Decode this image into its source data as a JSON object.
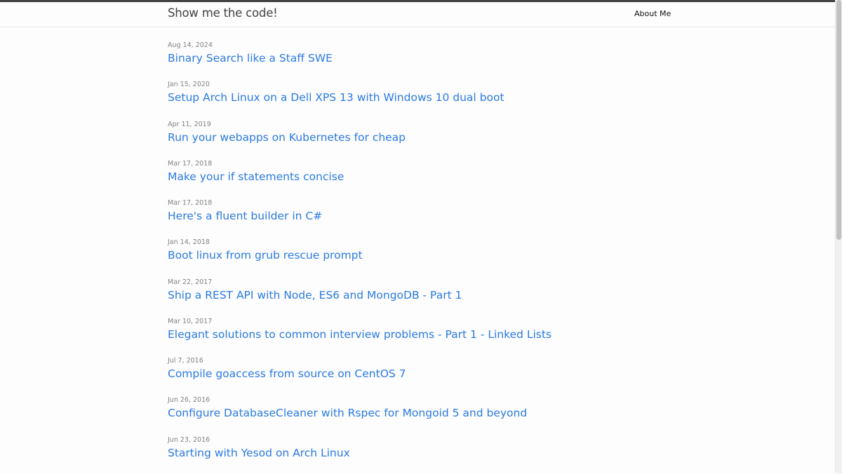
{
  "header": {
    "site_title": "Show me the code!",
    "nav_about": "About Me"
  },
  "posts": [
    {
      "date": "Aug 14, 2024",
      "title": "Binary Search like a Staff SWE"
    },
    {
      "date": "Jan 15, 2020",
      "title": "Setup Arch Linux on a Dell XPS 13 with Windows 10 dual boot"
    },
    {
      "date": "Apr 11, 2019",
      "title": "Run your webapps on Kubernetes for cheap"
    },
    {
      "date": "Mar 17, 2018",
      "title": "Make your if statements concise"
    },
    {
      "date": "Mar 17, 2018",
      "title": "Here's a fluent builder in C#"
    },
    {
      "date": "Jan 14, 2018",
      "title": "Boot linux from grub rescue prompt"
    },
    {
      "date": "Mar 22, 2017",
      "title": "Ship a REST API with Node, ES6 and MongoDB - Part 1"
    },
    {
      "date": "Mar 10, 2017",
      "title": "Elegant solutions to common interview problems - Part 1 - Linked Lists"
    },
    {
      "date": "Jul 7, 2016",
      "title": "Compile goaccess from source on CentOS 7"
    },
    {
      "date": "Jun 26, 2016",
      "title": "Configure DatabaseCleaner with Rspec for Mongoid 5 and beyond"
    },
    {
      "date": "Jun 23, 2016",
      "title": "Starting with Yesod on Arch Linux"
    }
  ],
  "colors": {
    "link": "#2a7ae2",
    "meta": "#828282",
    "title": "#424242",
    "top_bar": "#424242"
  }
}
